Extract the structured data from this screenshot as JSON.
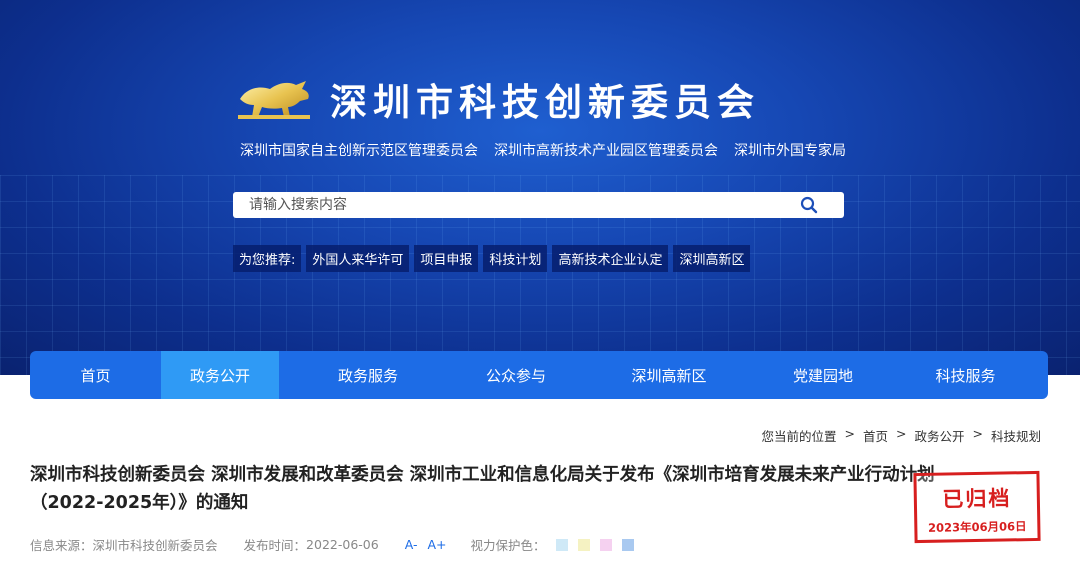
{
  "header": {
    "title": "深圳市科技创新委员会",
    "subtitles": [
      "深圳市国家自主创新示范区管理委员会",
      "深圳市高新技术产业园区管理委员会",
      "深圳市外国专家局"
    ]
  },
  "search": {
    "placeholder": "请输入搜索内容"
  },
  "recommend": {
    "label": "为您推荐:",
    "tags": [
      "外国人来华许可",
      "项目申报",
      "科技计划",
      "高新技术企业认定",
      "深圳高新区"
    ]
  },
  "nav": {
    "items": [
      "首页",
      "政务公开",
      "政务服务",
      "公众参与",
      "深圳高新区",
      "党建园地",
      "科技服务"
    ],
    "active_index": 1
  },
  "breadcrumb": {
    "prefix": "您当前的位置",
    "sep": ">",
    "items": [
      "首页",
      "政务公开",
      "科技规划"
    ]
  },
  "article": {
    "title_line1": "深圳市科技创新委员会 深圳市发展和改革委员会 深圳市工业和信息化局关于发布《深圳市培育发展未来产业行动计划",
    "title_line2": "（2022-2025年）》的通知",
    "source_label": "信息来源：",
    "source": "深圳市科技创新委员会",
    "date_label": "发布时间：",
    "date": "2022-06-06",
    "font_smaller": "A-",
    "font_larger": "A+",
    "eye_label": "视力保护色：",
    "eye_colors": [
      "#cfe9f7",
      "#f5f2c2",
      "#f5d1f0",
      "#a9c9f0"
    ]
  },
  "stamp": {
    "text": "已归档",
    "date": "2023年06月06日"
  },
  "colors": {
    "nav": "#1d6ce6",
    "nav_active": "#2f9af5",
    "stamp": "#d71f1f"
  }
}
